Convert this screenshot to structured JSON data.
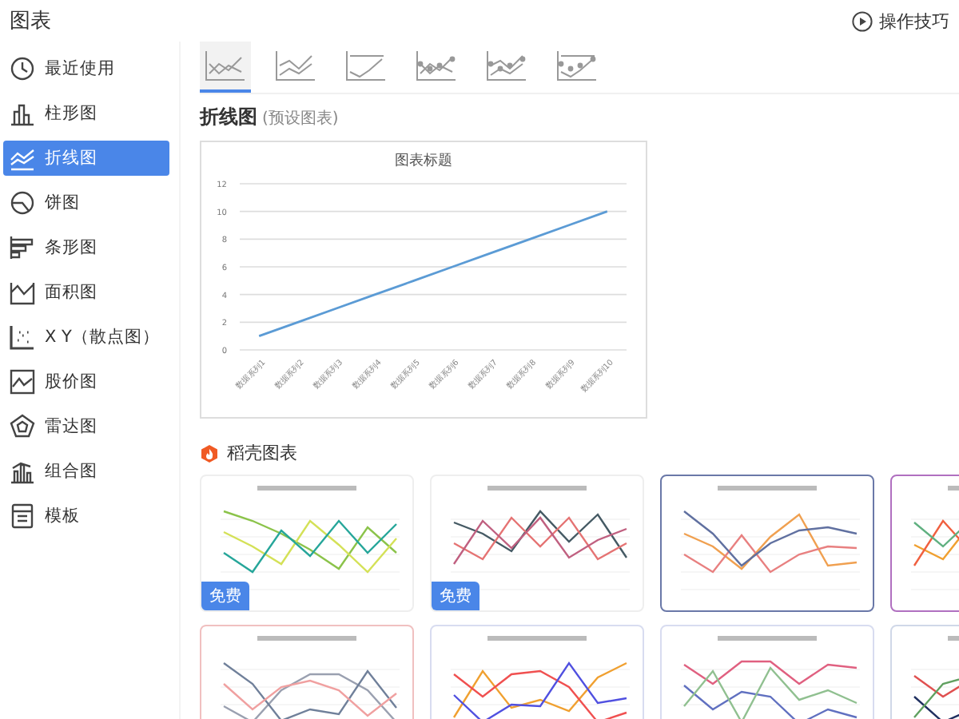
{
  "header": {
    "title": "图表",
    "help": "操作技巧"
  },
  "sidebar": {
    "items": [
      {
        "label": "最近使用",
        "kind": "recent",
        "selected": false
      },
      {
        "label": "柱形图",
        "kind": "column",
        "selected": false
      },
      {
        "label": "折线图",
        "kind": "line",
        "selected": true
      },
      {
        "label": "饼图",
        "kind": "pie",
        "selected": false
      },
      {
        "label": "条形图",
        "kind": "bar",
        "selected": false
      },
      {
        "label": "面积图",
        "kind": "area",
        "selected": false
      },
      {
        "label": "X Y（散点图）",
        "kind": "scatter",
        "selected": false
      },
      {
        "label": "股价图",
        "kind": "stock",
        "selected": false
      },
      {
        "label": "雷达图",
        "kind": "radar",
        "selected": false
      },
      {
        "label": "组合图",
        "kind": "combo",
        "selected": false
      },
      {
        "label": "模板",
        "kind": "template",
        "selected": false
      }
    ]
  },
  "subtypes": [
    {
      "kind": "line",
      "selected": true
    },
    {
      "kind": "stacked",
      "selected": false
    },
    {
      "kind": "percent",
      "selected": false
    },
    {
      "kind": "line-markers",
      "selected": false
    },
    {
      "kind": "stacked-markers",
      "selected": false
    },
    {
      "kind": "percent-markers",
      "selected": false
    }
  ],
  "preview": {
    "title": "折线图",
    "note": "(预设图表)",
    "chart_data": {
      "type": "line",
      "title": "图表标题",
      "categories": [
        "数据系列1",
        "数据系列2",
        "数据系列3",
        "数据系列4",
        "数据系列5",
        "数据系列6",
        "数据系列7",
        "数据系列8",
        "数据系列9",
        "数据系列10"
      ],
      "series": [
        {
          "color": "#5b9bd5",
          "values": [
            1,
            2,
            3,
            4,
            5,
            6,
            7,
            8,
            9,
            10
          ]
        }
      ],
      "ylim": [
        0,
        12
      ],
      "yticks": [
        0,
        2,
        4,
        6,
        8,
        10,
        12
      ],
      "grid": true
    }
  },
  "templates": {
    "title": "稻壳图表",
    "items": [
      {
        "kind": "plain",
        "badge": "免费"
      },
      {
        "kind": "plain",
        "badge": "免费"
      },
      {
        "kind": "navy"
      },
      {
        "kind": "purple"
      },
      {
        "kind": "pink"
      },
      {
        "kind": "lavender"
      },
      {
        "kind": "lavender"
      },
      {
        "kind": "steel"
      }
    ]
  }
}
